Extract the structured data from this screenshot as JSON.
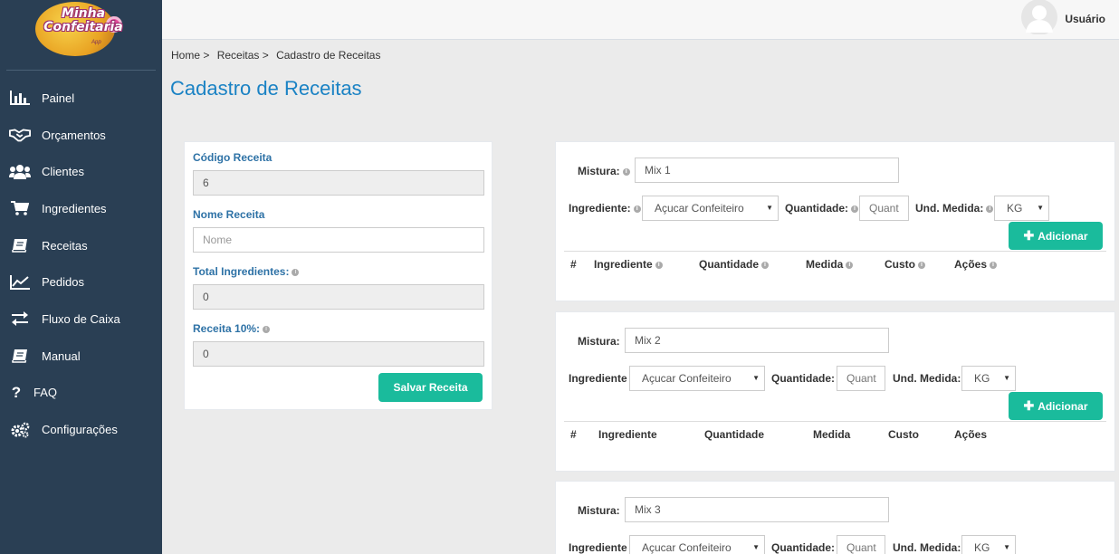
{
  "app": {
    "logo_text_1": "Minha",
    "logo_text_2": "Confeitaria",
    "logo_text_3": "App"
  },
  "sidebar": {
    "items": [
      {
        "label": "Painel",
        "icon": "bar-chart-icon"
      },
      {
        "label": "Orçamentos",
        "icon": "handshake-icon"
      },
      {
        "label": "Clientes",
        "icon": "users-icon"
      },
      {
        "label": "Ingredientes",
        "icon": "cart-icon"
      },
      {
        "label": "Receitas",
        "icon": "book-icon"
      },
      {
        "label": "Pedidos",
        "icon": "line-chart-icon"
      },
      {
        "label": "Fluxo de Caixa",
        "icon": "exchange-icon"
      },
      {
        "label": "Manual",
        "icon": "book-icon"
      },
      {
        "label": "FAQ",
        "icon": "question-icon"
      },
      {
        "label": "Configurações",
        "icon": "gears-icon"
      }
    ]
  },
  "header": {
    "user_name": "Usuário"
  },
  "breadcrumb": [
    "Home >",
    "Receitas >",
    "Cadastro de Receitas"
  ],
  "page_title": "Cadastro de Receitas",
  "form": {
    "codigo_label": "Código Receita",
    "codigo_value": "6",
    "nome_label": "Nome Receita",
    "nome_placeholder": "Nome",
    "total_label": "Total Ingredientes:",
    "total_value": "0",
    "receita10_label": "Receita 10%:",
    "receita10_value": "0",
    "save_label": "Salvar Receita"
  },
  "mixes": [
    {
      "mistura_label": "Mistura:",
      "mistura_value": "Mix 1",
      "ingrediente_label": "Ingrediente:",
      "ingrediente_value": "Açucar Confeiteiro",
      "quantidade_label": "Quantidade:",
      "quantidade_placeholder": "Quant",
      "und_label": "Und. Medida:",
      "und_value": "KG",
      "add_label": "Adicionar",
      "columns": [
        "#",
        "Ingrediente",
        "Quantidade",
        "Medida",
        "Custo",
        "Ações"
      ]
    },
    {
      "mistura_label": "Mistura:",
      "mistura_value": "Mix 2",
      "ingrediente_label": "Ingrediente",
      "ingrediente_value": "Açucar Confeiteiro",
      "quantidade_label": "Quantidade:",
      "quantidade_placeholder": "Quant",
      "und_label": "Und. Medida:",
      "und_value": "KG",
      "add_label": "Adicionar",
      "columns": [
        "#",
        "Ingrediente",
        "Quantidade",
        "Medida",
        "Custo",
        "Ações"
      ]
    },
    {
      "mistura_label": "Mistura:",
      "mistura_value": "Mix 3",
      "ingrediente_label": "Ingrediente",
      "ingrediente_value": "Açucar Confeiteiro",
      "quantidade_label": "Quantidade:",
      "quantidade_placeholder": "Quant",
      "und_label": "Und. Medida:",
      "und_value": "KG"
    }
  ],
  "colors": {
    "sidebar_bg": "#2a3f54",
    "accent_green": "#1abb9c",
    "title_blue": "#1a82c4"
  }
}
